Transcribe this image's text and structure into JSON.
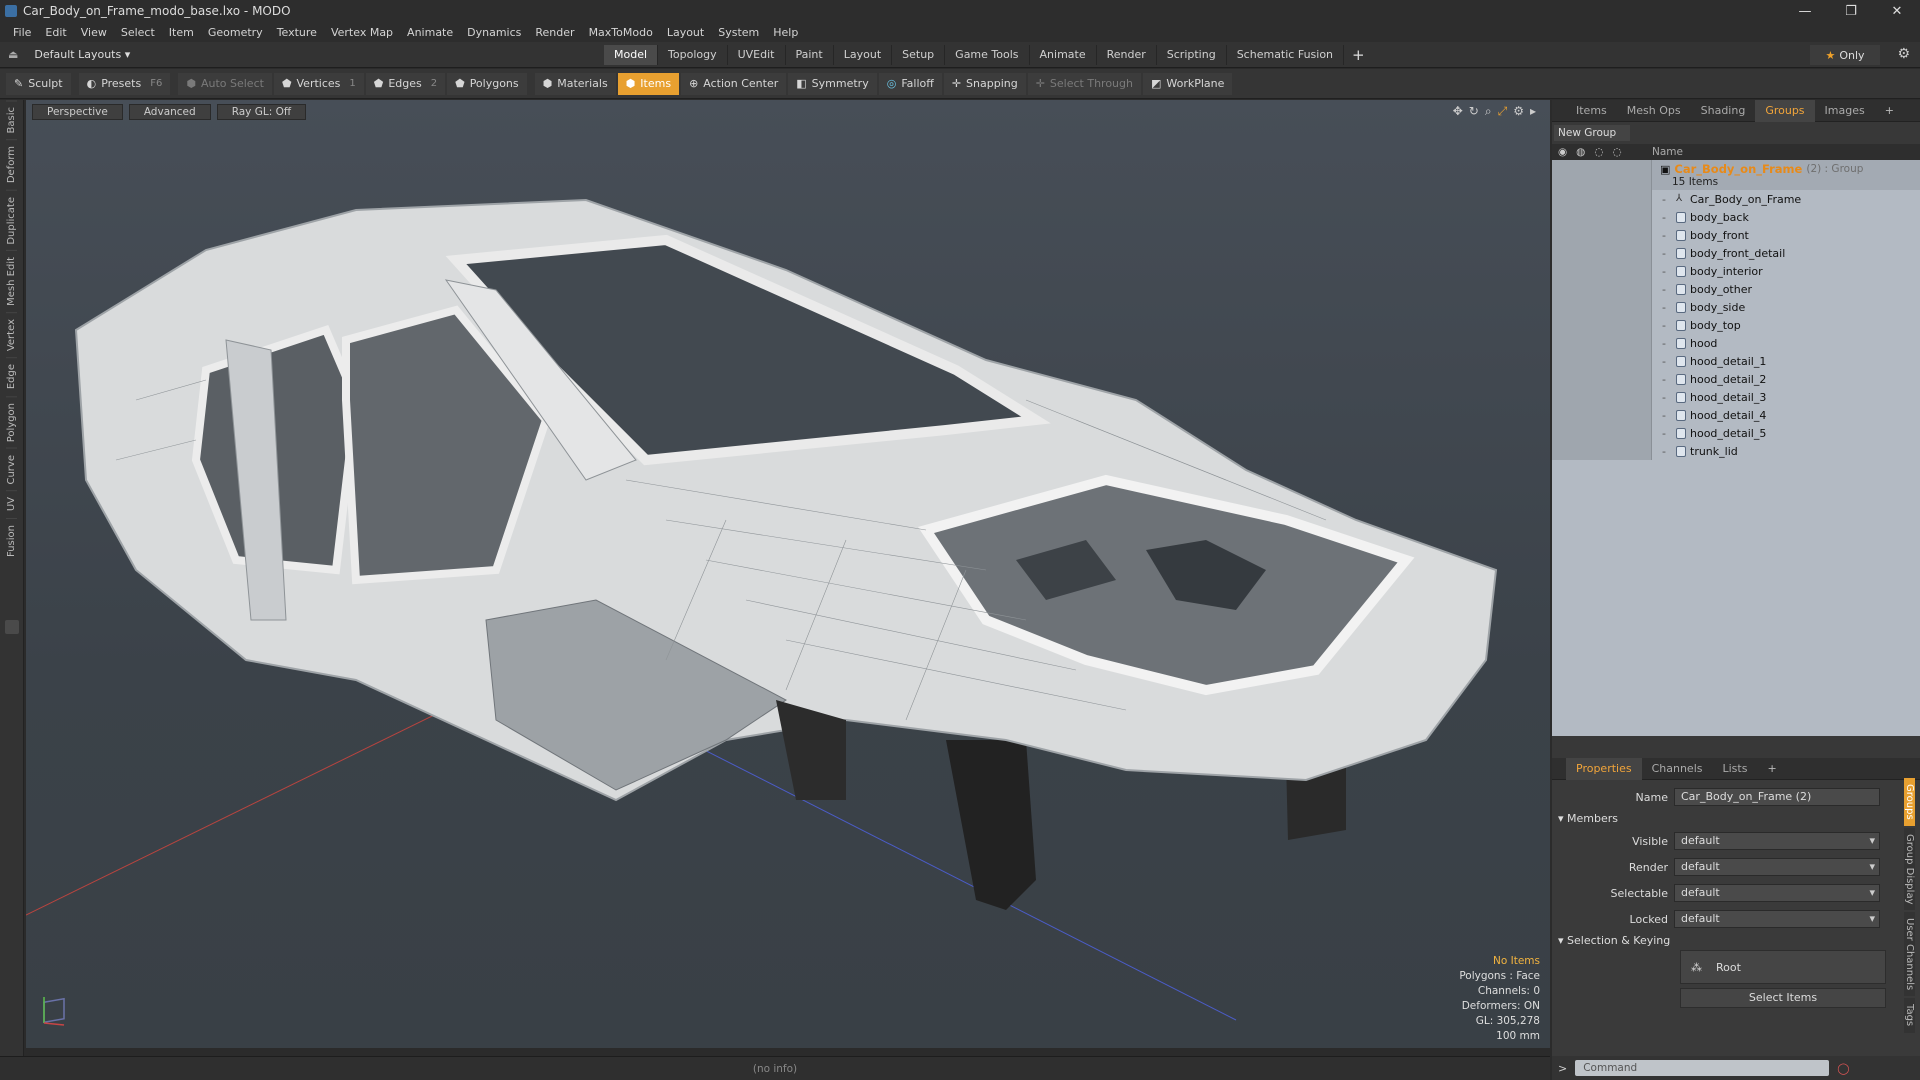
{
  "window": {
    "title": "Car_Body_on_Frame_modo_base.lxo - MODO",
    "controls": [
      "—",
      "❐",
      "✕"
    ]
  },
  "menu": [
    "File",
    "Edit",
    "View",
    "Select",
    "Item",
    "Geometry",
    "Texture",
    "Vertex Map",
    "Animate",
    "Dynamics",
    "Render",
    "MaxToModo",
    "Layout",
    "System",
    "Help"
  ],
  "layout": {
    "selector": "Default Layouts ▾",
    "tabs": [
      "Model",
      "Topology",
      "UVEdit",
      "Paint",
      "Layout",
      "Setup",
      "Game Tools",
      "Animate",
      "Render",
      "Scripting",
      "Schematic Fusion"
    ],
    "active_tab": "Model",
    "only_label": "Only"
  },
  "toolbar": {
    "sculpt": "Sculpt",
    "presets": "Presets",
    "presets_key": "F6",
    "auto_select": "Auto Select",
    "vertices": "Vertices",
    "vertices_key": "1",
    "edges": "Edges",
    "edges_key": "2",
    "polygons": "Polygons",
    "materials": "Materials",
    "items": "Items",
    "action_center": "Action Center",
    "symmetry": "Symmetry",
    "falloff": "Falloff",
    "snapping": "Snapping",
    "select_through": "Select Through",
    "workplane": "WorkPlane"
  },
  "left_tabs": [
    "Basic",
    "Deform",
    "Duplicate",
    "Mesh Edit",
    "Vertex",
    "Edge",
    "Polygon",
    "Curve",
    "UV",
    "Fusion"
  ],
  "viewport": {
    "view": "Perspective",
    "shading": "Advanced",
    "raygl": "Ray GL: Off",
    "stats": {
      "items": "No Items",
      "polygons": "Polygons : Face",
      "channels": "Channels: 0",
      "deformers": "Deformers: ON",
      "gl": "GL: 305,278",
      "scale": "100 mm"
    }
  },
  "status": "(no info)",
  "panel_tabs": {
    "items": [
      "Items",
      "Mesh Ops",
      "Shading",
      "Groups",
      "Images"
    ],
    "active": "Groups"
  },
  "groups": {
    "new_group": "New Group",
    "name_header": "Name",
    "group_name": "Car_Body_on_Frame",
    "group_suffix": "(2) : Group",
    "count": "15 Items",
    "members": [
      "Car_Body_on_Frame",
      "body_back",
      "body_front",
      "body_front_detail",
      "body_interior",
      "body_other",
      "body_side",
      "body_top",
      "hood",
      "hood_detail_1",
      "hood_detail_2",
      "hood_detail_3",
      "hood_detail_4",
      "hood_detail_5",
      "trunk_lid"
    ]
  },
  "props_tabs": {
    "items": [
      "Properties",
      "Channels",
      "Lists"
    ],
    "active": "Properties"
  },
  "properties": {
    "name_label": "Name",
    "name_value": "Car_Body_on_Frame (2)",
    "members_label": "Members",
    "visible_label": "Visible",
    "visible": "default",
    "render_label": "Render",
    "render": "default",
    "selectable_label": "Selectable",
    "selectable": "default",
    "locked_label": "Locked",
    "locked": "default",
    "sel_keying": "Selection & Keying",
    "root": "Root",
    "select_items": "Select Items"
  },
  "side_tabs": [
    "Groups",
    "Group Display",
    "User Channels",
    "Tags"
  ],
  "command": {
    "placeholder": "Command"
  },
  "colors": {
    "accent": "#e8a030",
    "group_name": "#e88a18"
  }
}
